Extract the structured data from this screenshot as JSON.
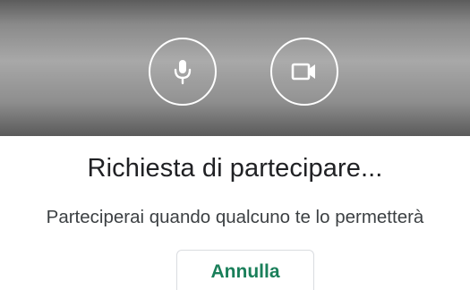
{
  "status_bar": {
    "text": "..........."
  },
  "preview": {
    "mic_icon": "microphone-icon",
    "camera_icon": "video-camera-icon",
    "icon_color": "#ffffff"
  },
  "join": {
    "title": "Richiesta di partecipare...",
    "subtitle": "Parteciperai quando qualcuno te lo permetterà",
    "cancel_label": "Annulla"
  },
  "colors": {
    "accent": "#1a7f5a",
    "title_text": "#202124",
    "subtitle_text": "#3c4043",
    "button_border": "#dadce0"
  }
}
